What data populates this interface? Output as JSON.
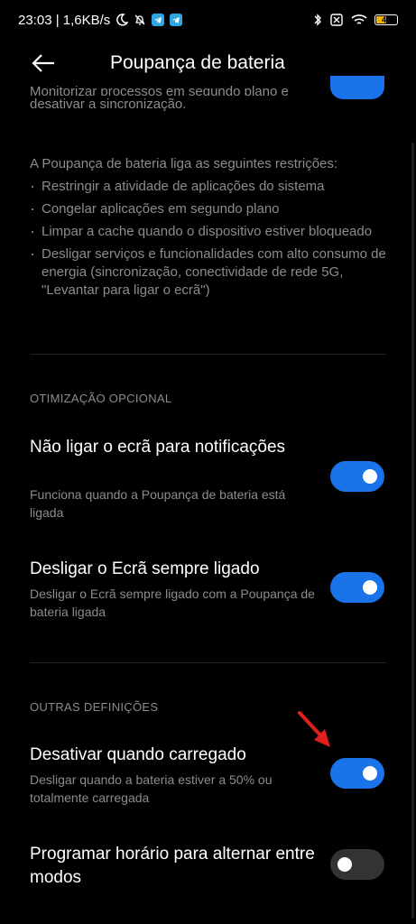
{
  "status_bar": {
    "time_speed": "23:03 | 1,6KB/s",
    "battery": "49"
  },
  "header": {
    "title": "Poupança de bateria"
  },
  "cutoff": {
    "line1": "Monitorizar processos em segundo plano e",
    "line2": "desativar a sincronização."
  },
  "restrictions": {
    "intro": "A Poupança de bateria liga as seguintes restrições:",
    "items": [
      "Restringir a atividade de aplicações do sistema",
      "Congelar aplicações em segundo plano",
      "Limpar a cache quando o dispositivo estiver bloqueado",
      "Desligar serviços e funcionalidades com alto consumo de energia (sincronização, conectividade de rede 5G, \"Levantar para ligar o ecrã\")"
    ]
  },
  "sections": {
    "optional": "OTIMIZAÇÃO OPCIONAL",
    "other": "OUTRAS DEFINIÇÕES"
  },
  "settings": {
    "no_screen": {
      "title": "Não ligar o ecrã para notificações",
      "desc": "Funciona quando a Poupança de bateria está ligada",
      "enabled": true
    },
    "aod": {
      "title": "Desligar o Ecrã sempre ligado",
      "desc": "Desligar o Ecrã sempre ligado com a Poupança de bateria ligada",
      "enabled": true
    },
    "charged": {
      "title": "Desativar quando carregado",
      "desc": "Desligar quando a bateria estiver a 50% ou totalmente carregada",
      "enabled": true
    },
    "schedule": {
      "title": "Programar horário para alternar entre modos",
      "enabled": false
    }
  },
  "colors": {
    "accent": "#1a73e8",
    "arrow": "#e0201c"
  }
}
